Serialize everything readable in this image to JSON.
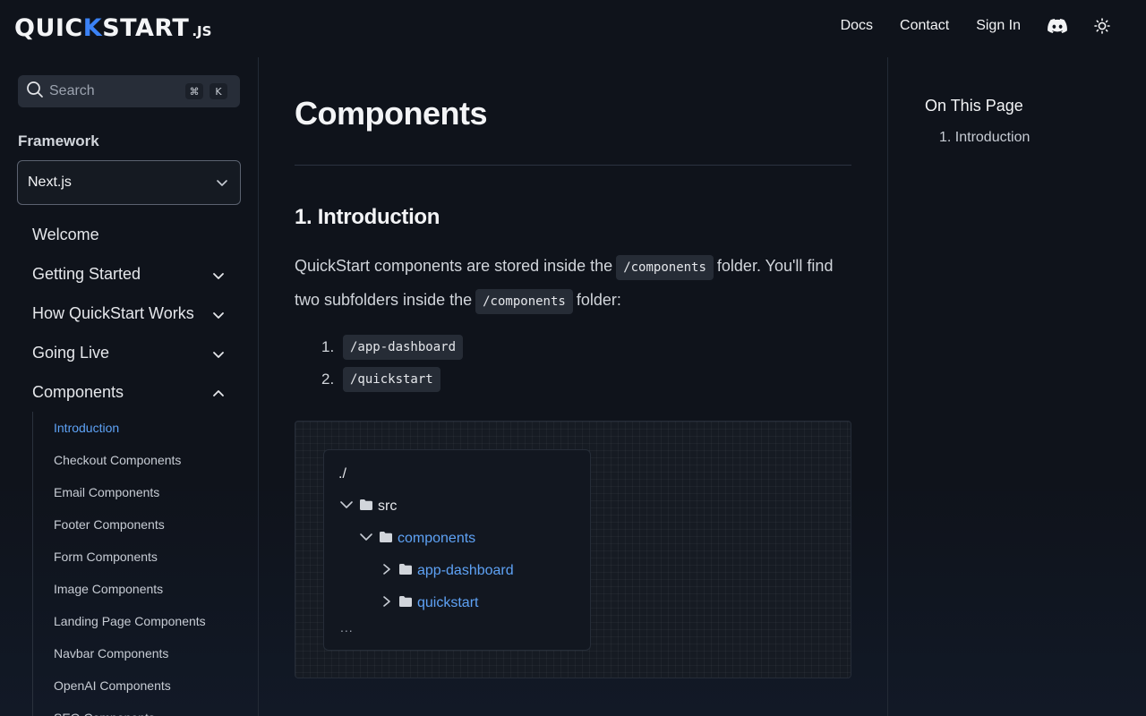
{
  "header": {
    "logo_main_a": "QUICK",
    "logo_main_b": "START",
    "logo_sub": ".JS",
    "nav": {
      "docs": "Docs",
      "contact": "Contact",
      "sign_in": "Sign In"
    },
    "icons": {
      "discord": "discord-icon",
      "theme": "sun-icon"
    }
  },
  "sidebar": {
    "search": {
      "label": "Search",
      "shortcut_mod": "⌘",
      "shortcut_key": "K"
    },
    "framework_label": "Framework",
    "framework_value": "Next.js",
    "items": [
      {
        "label": "Welcome"
      },
      {
        "label": "Getting Started"
      },
      {
        "label": "How QuickStart Works"
      },
      {
        "label": "Going Live"
      },
      {
        "label": "Components"
      }
    ],
    "sub_items": [
      {
        "label": "Introduction"
      },
      {
        "label": "Checkout Components"
      },
      {
        "label": "Email Components"
      },
      {
        "label": "Footer Components"
      },
      {
        "label": "Form Components"
      },
      {
        "label": "Image Components"
      },
      {
        "label": "Landing Page Components"
      },
      {
        "label": "Navbar Components"
      },
      {
        "label": "OpenAI Components"
      },
      {
        "label": "SEO Components"
      }
    ]
  },
  "main": {
    "title": "Components",
    "section_title": "1. Introduction",
    "para_1": "QuickStart components are stored inside the",
    "code_components": "/components",
    "para_2": "folder. You'll find two subfolders inside the",
    "para_3": "folder:",
    "list": [
      {
        "num": "1.",
        "code": "/app-dashboard"
      },
      {
        "num": "2.",
        "code": "/quickstart"
      }
    ],
    "tree": {
      "root": "./",
      "src": "src",
      "components": "components",
      "app_dashboard": "app-dashboard",
      "quickstart": "quickstart",
      "more": "..."
    }
  },
  "toc": {
    "title": "On This Page",
    "items": [
      {
        "label": "1. Introduction"
      }
    ]
  },
  "colors": {
    "accent": "#5ea2f5",
    "background": "#0f131b"
  }
}
